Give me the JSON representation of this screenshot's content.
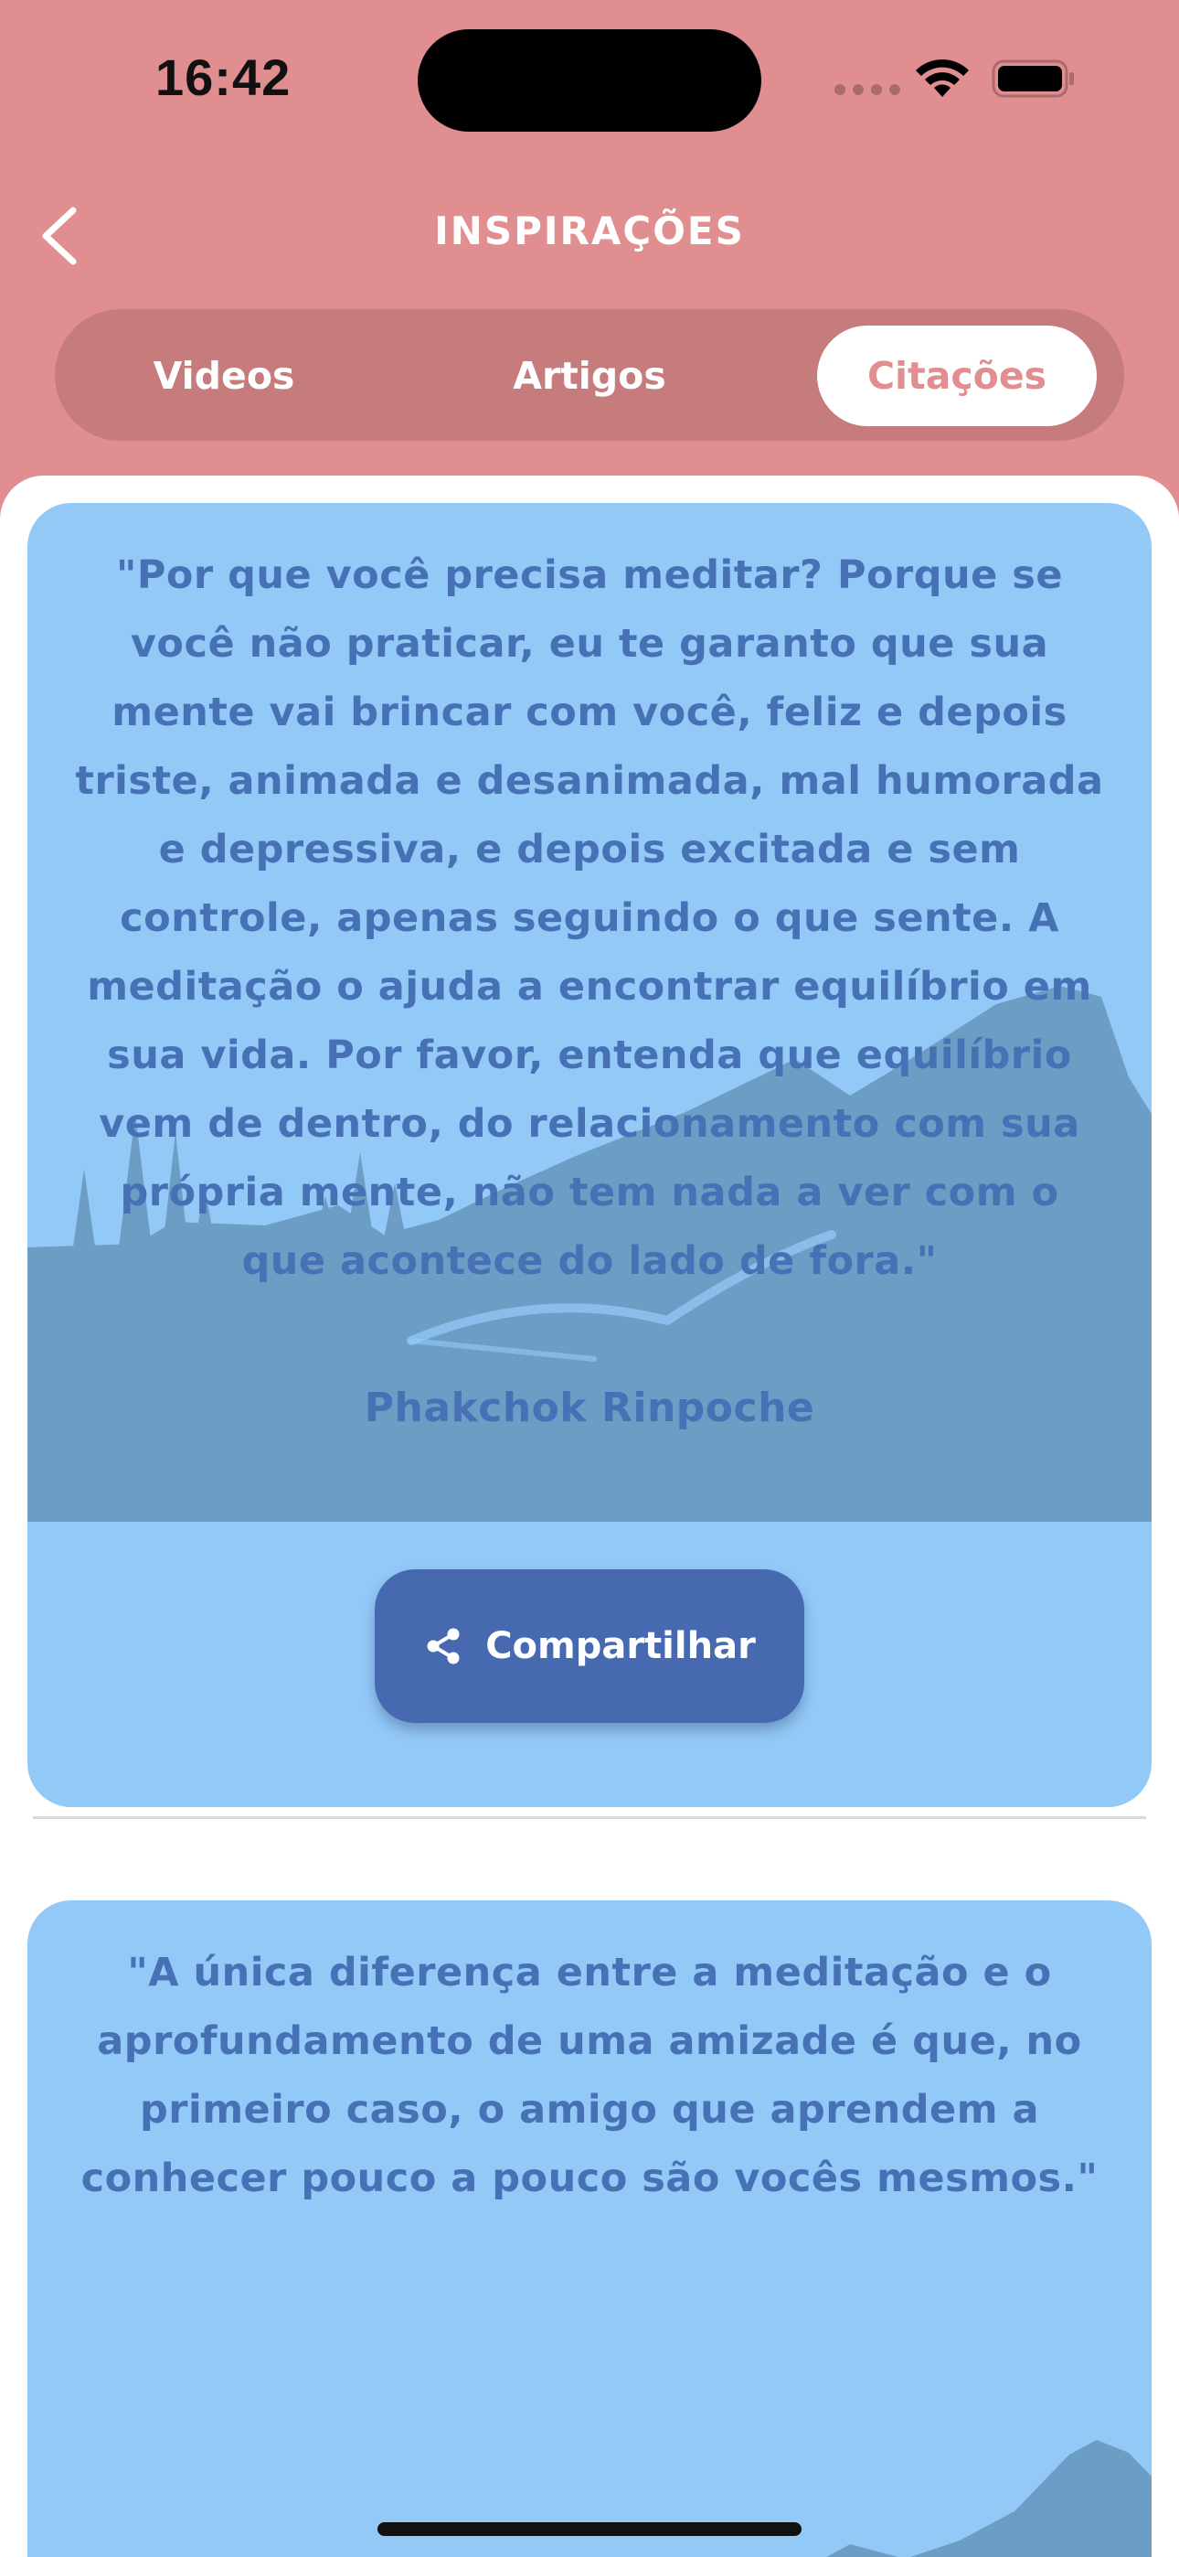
{
  "status_bar": {
    "time": "16:42"
  },
  "header": {
    "title": "INSPIRAÇÕES",
    "back_icon": "chevron-left-icon"
  },
  "tabs": [
    {
      "label": "Videos",
      "selected": false
    },
    {
      "label": "Artigos",
      "selected": false
    },
    {
      "label": "Citações",
      "selected": true
    }
  ],
  "quotes": [
    {
      "text": "\"Por que você precisa meditar? Porque se você não praticar, eu te garanto que sua mente vai brincar com você, feliz e depois triste, animada e desanimada, mal humorada e depressiva, e depois excitada e sem controle, apenas seguindo o que sente. A meditação o ajuda a encontrar equilíbrio em sua vida. Por favor, entenda que equilíbrio vem de dentro, do relacionamento com sua própria mente, não tem nada a ver com o que acontece do lado de fora.\"",
      "author": "Phakchok Rinpoche",
      "share_label": "Compartilhar"
    },
    {
      "text": "\"A única diferença entre a meditação e o aprofundamento de uma amizade é que, no primeiro caso, o amigo que aprendem a conhecer pouco a pouco são vocês mesmos.\""
    }
  ],
  "colors": {
    "header_background": "#e08e8f",
    "tabs_background": "#c67b7c",
    "card_background": "#93c9f7",
    "mountain_color": "#6b9dc5",
    "text_color": "#4771b5",
    "button_color": "#4669b0"
  }
}
